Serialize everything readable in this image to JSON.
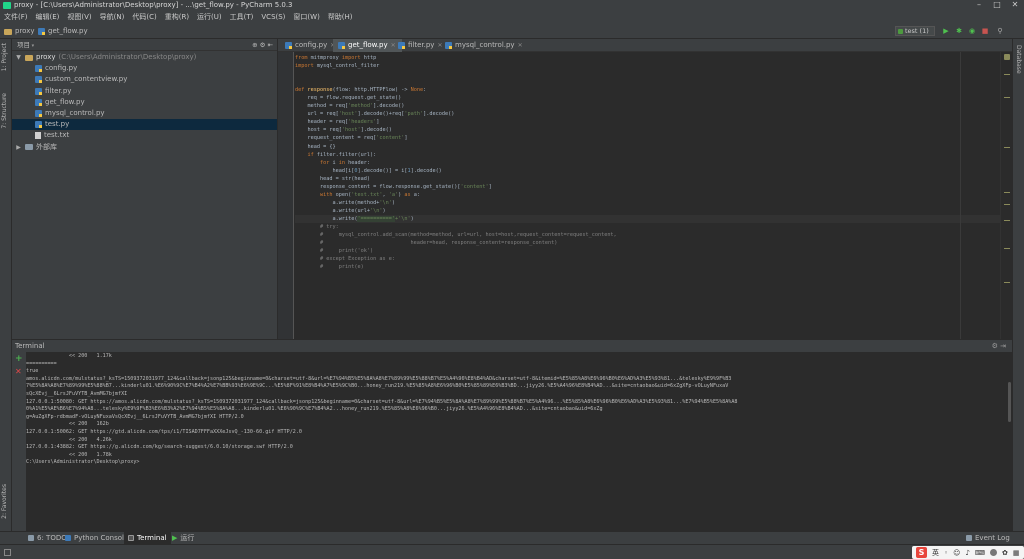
{
  "window": {
    "title": "proxy - [C:\\Users\\Administrator\\Desktop\\proxy] - ...\\get_flow.py - PyCharm 5.0.3"
  },
  "menu": [
    "文件(F)",
    "编辑(E)",
    "视图(V)",
    "导航(N)",
    "代码(C)",
    "重构(R)",
    "运行(U)",
    "工具(T)",
    "VCS(S)",
    "窗口(W)",
    "帮助(H)"
  ],
  "navbar": {
    "crumbs": [
      "proxy",
      "get_flow.py"
    ],
    "run_config": "test (1)"
  },
  "project": {
    "header": "项目",
    "root_name": "proxy",
    "root_path": "(C:\\Users\\Administrator\\Desktop\\proxy)",
    "files": [
      "config.py",
      "custom_contentview.py",
      "filter.py",
      "get_flow.py",
      "mysql_control.py",
      "test.py",
      "test.txt"
    ],
    "external": "外部库"
  },
  "stripes": {
    "left": [
      "1: Project",
      "7: Structure",
      "2: Favorites"
    ],
    "right": [
      "Database"
    ]
  },
  "editor": {
    "tabs": [
      "config.py",
      "get_flow.py",
      "filter.py",
      "mysql_control.py"
    ],
    "active_tab": "get_flow.py"
  },
  "terminal": {
    "title": "Terminal",
    "lines": [
      "              << 200   1.17k",
      "==========",
      "true",
      "amos.alicdn.com/mulstatus?_ksTS=1509372031977_124&callback=jsonp125&beginname=0&charset=utf-8&url=%E7%94%B5%E5%8A%A8%E7%89%99%E5%88%B7%E5%A4%96%E8%B4%AD&charset=utf-8&itemid=%E5%85%A8%E6%96%B0%E6%AD%A3%E5%93%81...&telesky%E9%9F%B3",
      "7%E5%8A%A8%E7%89%99%E5%88%B7...kinderlu01.%E6%90%9C%E7%B4%A2%E7%BB%93%E6%9E%9C...%E5%8F%91%E8%B4%A7%E5%9C%B0...honey_run219.%E5%85%A8%E6%96%B0%E5%85%89%E6%B3%BD...jiyy26.%E5%A4%96%E8%B4%AD...&site=cntaobao&uid=6xZgXFp-vOLuyNFuxaV",
      "sQcXEvj__6LrsJFuVYTB_AvmMG7bjmfXI",
      "127.0.0.1:50080: GET https://amos.alicdn.com/mulstatus?_ksTS=1509372031977_124&callback=jsonp125&beginname=0&charset=utf-8&url=%E7%94%B5%E5%8A%A8%E7%89%99%E5%88%B7%E5%A4%96...%E5%85%A8%E6%96%B0%E6%AD%A3%E5%93%81...%E7%94%B5%E5%8A%A8",
      "0%A1%E5%AE%B6%E7%94%A8...telesky%E9%9F%B3%E6%B3%A2%E7%94%B5%E5%8A%A8...kinderlu01.%E6%90%9C%E7%B4%A2...honey_run219.%E5%85%A8%E6%96%B0...jiyy26.%E5%A4%96%E8%B4%AD...&site=cntaobao&uid=6xZg",
      "g=AuZgXFp-rdbmadF-vOLuyNFuxaVsQcXEvj__6LrsJFuVYTB_AvmMG7bjmfXI HTTP/2.0",
      "              << 200   162b",
      "127.0.0.1:50062: GET https://gtd.alicdn.com/tps/i1/TISAD7FFFaXXXeJsvQ_-130-60.gif HTTP/2.0",
      "              << 200   4.26k",
      "127.0.0.1:43882: GET https://g.alicdn.com/kg/search-suggest/6.0.10/storage.swf HTTP/2.0",
      "              << 200   1.78k",
      "",
      "C:\\Users\\Administrator\\Desktop\\proxy>"
    ]
  },
  "bottom_tabs": [
    "6: TODO",
    "Python Console",
    "Terminal",
    "运行"
  ],
  "statusbar": {
    "ime_label": "英",
    "event_log": "Event Log"
  }
}
